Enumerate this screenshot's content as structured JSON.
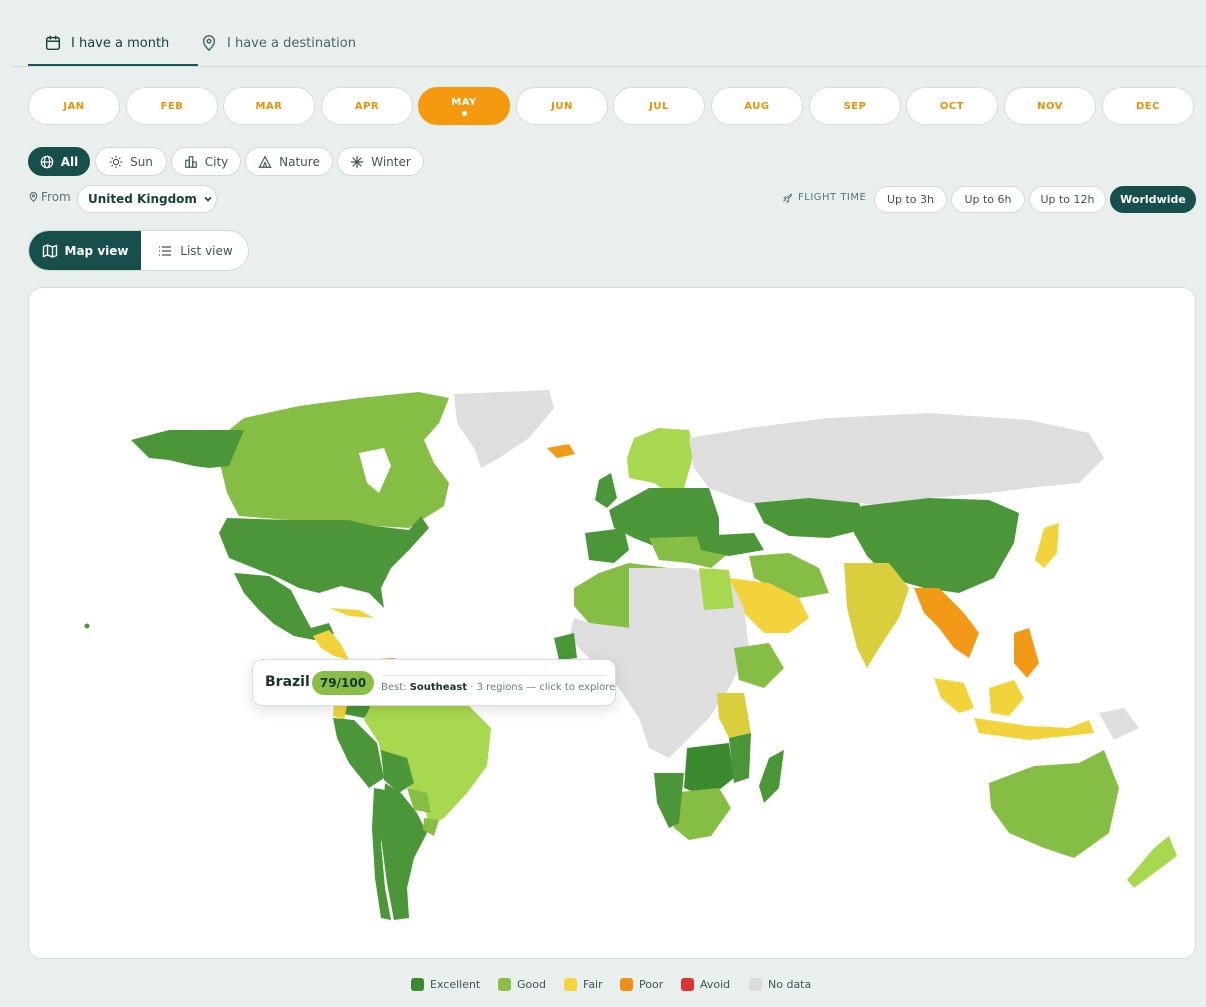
{
  "top_tabs": [
    {
      "label": "I have a month",
      "icon": "calendar-icon",
      "active": true
    },
    {
      "label": "I have a destination",
      "icon": "map-pin-icon",
      "active": false
    }
  ],
  "months": [
    "JAN",
    "FEB",
    "MAR",
    "APR",
    "MAY",
    "JUN",
    "JUL",
    "AUG",
    "SEP",
    "OCT",
    "NOV",
    "DEC"
  ],
  "selected_month": "MAY",
  "categories": [
    {
      "label": "All",
      "icon": "globe-icon",
      "active": true
    },
    {
      "label": "Sun",
      "icon": "sun-icon",
      "active": false
    },
    {
      "label": "City",
      "icon": "city-icon",
      "active": false
    },
    {
      "label": "Nature",
      "icon": "tent-icon",
      "active": false
    },
    {
      "label": "Winter",
      "icon": "snowflake-icon",
      "active": false
    }
  ],
  "from": {
    "label": "From",
    "value": "United Kingdom"
  },
  "flight_time": {
    "label": "FLIGHT TIME",
    "options": [
      "Up to 3h",
      "Up to 6h",
      "Up to 12h",
      "Worldwide"
    ],
    "selected": "Worldwide"
  },
  "view_toggle": {
    "map_label": "Map view",
    "list_label": "List view",
    "selected": "Map view"
  },
  "tooltip": {
    "country": "Brazil",
    "score": "79/100",
    "best_prefix": "Best:",
    "best_region": "Southeast",
    "detail": "· 3 regions — click to explore"
  },
  "legend": [
    {
      "label": "Excellent",
      "color": "#3c8a30"
    },
    {
      "label": "Good",
      "color": "#8bbe46"
    },
    {
      "label": "Fair",
      "color": "#f3d43a"
    },
    {
      "label": "Poor",
      "color": "#f08f18"
    },
    {
      "label": "Avoid",
      "color": "#d93535"
    },
    {
      "label": "No data",
      "color": "#dcdcdc"
    }
  ],
  "colors": {
    "excellent": "#4a9638",
    "good": "#86bd45",
    "good_light": "#a8d84f",
    "fair": "#d9cf3d",
    "fair_yellow": "#f2d33b",
    "poor": "#f29a17",
    "nodata": "#dedede",
    "accent": "#164f4b",
    "month_accent": "#f59a0f"
  }
}
